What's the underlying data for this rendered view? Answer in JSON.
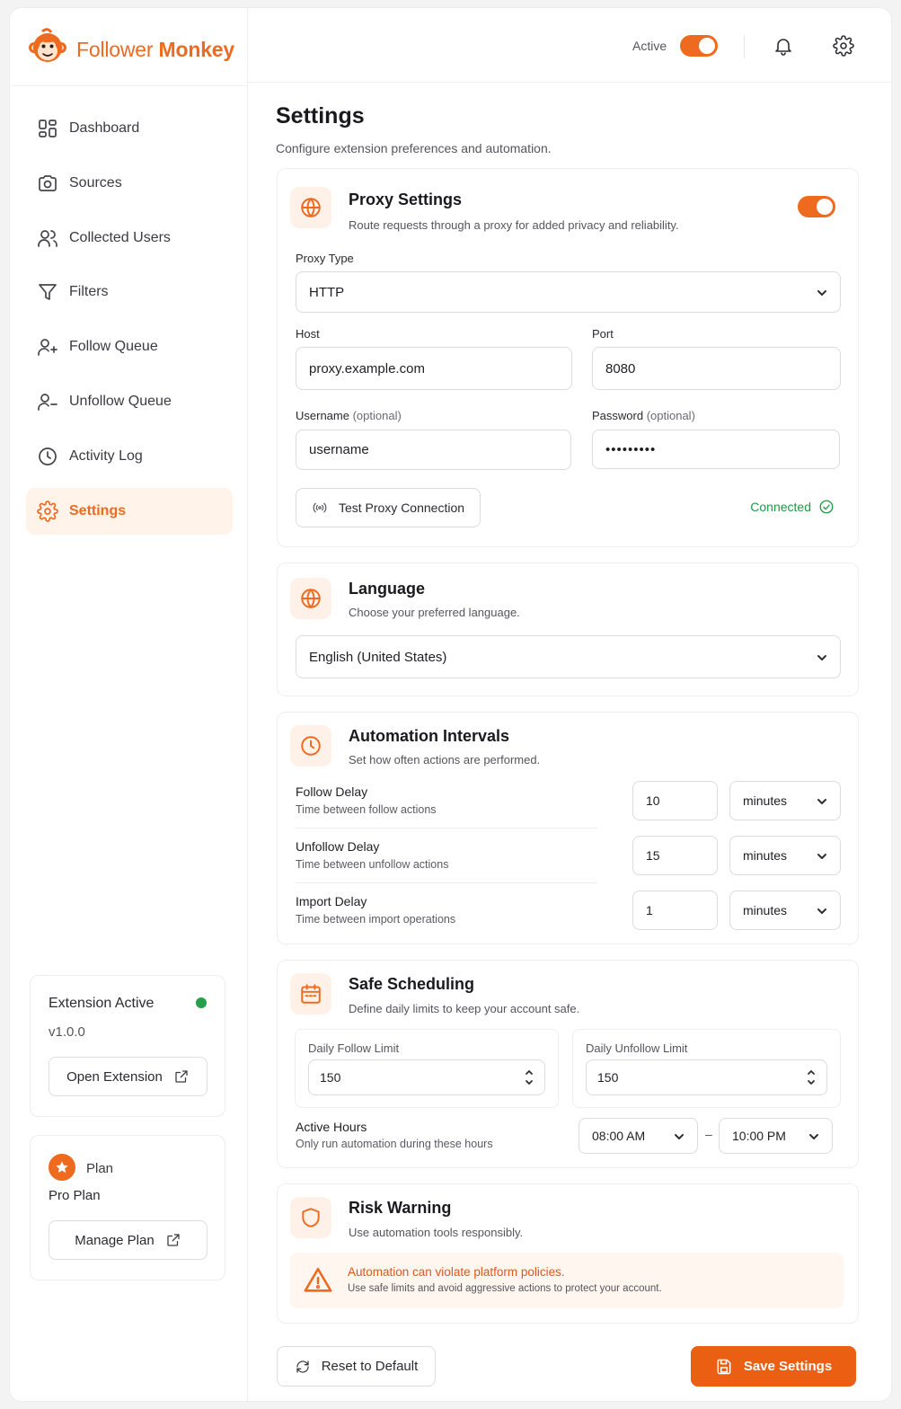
{
  "app": {
    "name_part1": "Follower",
    "name_part2": "Monkey"
  },
  "sidebar": {
    "items": [
      {
        "label": "Dashboard",
        "icon": "dashboard-icon"
      },
      {
        "label": "Sources",
        "icon": "camera-icon"
      },
      {
        "label": "Collected Users",
        "icon": "users-icon"
      },
      {
        "label": "Filters",
        "icon": "filter-icon"
      },
      {
        "label": "Follow Queue",
        "icon": "user-plus-icon"
      },
      {
        "label": "Unfollow Queue",
        "icon": "user-minus-icon"
      },
      {
        "label": "Activity Log",
        "icon": "clock-icon"
      },
      {
        "label": "Settings",
        "icon": "gear-icon",
        "active": true
      }
    ],
    "extension_card": {
      "title": "Extension Active",
      "version": "v1.0.0",
      "button": "Open Extension",
      "status_color": "#27a04a"
    },
    "plan_card": {
      "label": "Plan",
      "plan_name": "Pro Plan",
      "button": "Manage Plan"
    }
  },
  "topbar": {
    "active_label": "Active",
    "active_on": true
  },
  "page": {
    "title": "Settings",
    "subtitle": "Configure extension preferences and automation."
  },
  "proxy": {
    "title": "Proxy Settings",
    "subtitle": "Route requests through a proxy for added privacy and reliability.",
    "enabled": true,
    "type_label": "Proxy Type",
    "type_value": "HTTP",
    "host_label": "Host",
    "host_value": "proxy.example.com",
    "port_label": "Port",
    "port_value": "8080",
    "username_label": "Username",
    "username_optional": "(optional)",
    "username_value": "username",
    "password_label": "Password",
    "password_optional": "(optional)",
    "password_value": "•••••••••",
    "test_button": "Test Proxy Connection",
    "status": "Connected"
  },
  "language": {
    "title": "Language",
    "subtitle": "Choose your preferred language.",
    "value": "English (United States)"
  },
  "intervals": {
    "title": "Automation Intervals",
    "subtitle": "Set how often actions are performed.",
    "rows": [
      {
        "title": "Follow Delay",
        "desc": "Time between follow actions",
        "value": "10",
        "unit": "minutes"
      },
      {
        "title": "Unfollow Delay",
        "desc": "Time between unfollow actions",
        "value": "15",
        "unit": "minutes"
      },
      {
        "title": "Import Delay",
        "desc": "Time between import operations",
        "value": "1",
        "unit": "minutes"
      }
    ]
  },
  "scheduling": {
    "title": "Safe Scheduling",
    "subtitle": "Define daily limits to keep your account safe.",
    "follow_limit_label": "Daily Follow Limit",
    "follow_limit_value": "150",
    "unfollow_limit_label": "Daily Unfollow Limit",
    "unfollow_limit_value": "150",
    "hours_title": "Active Hours",
    "hours_desc": "Only run automation during these hours",
    "start": "08:00 AM",
    "separator": "–",
    "end": "10:00 PM"
  },
  "risk": {
    "title": "Risk Warning",
    "subtitle": "Use automation tools responsibly.",
    "warning_title": "Automation can violate platform policies.",
    "warning_text": "Use safe limits and avoid aggressive actions to protect your account."
  },
  "actions": {
    "reset": "Reset to Default",
    "save": "Save Settings"
  },
  "colors": {
    "accent": "#ee6a1f",
    "success": "#1f9a45"
  }
}
